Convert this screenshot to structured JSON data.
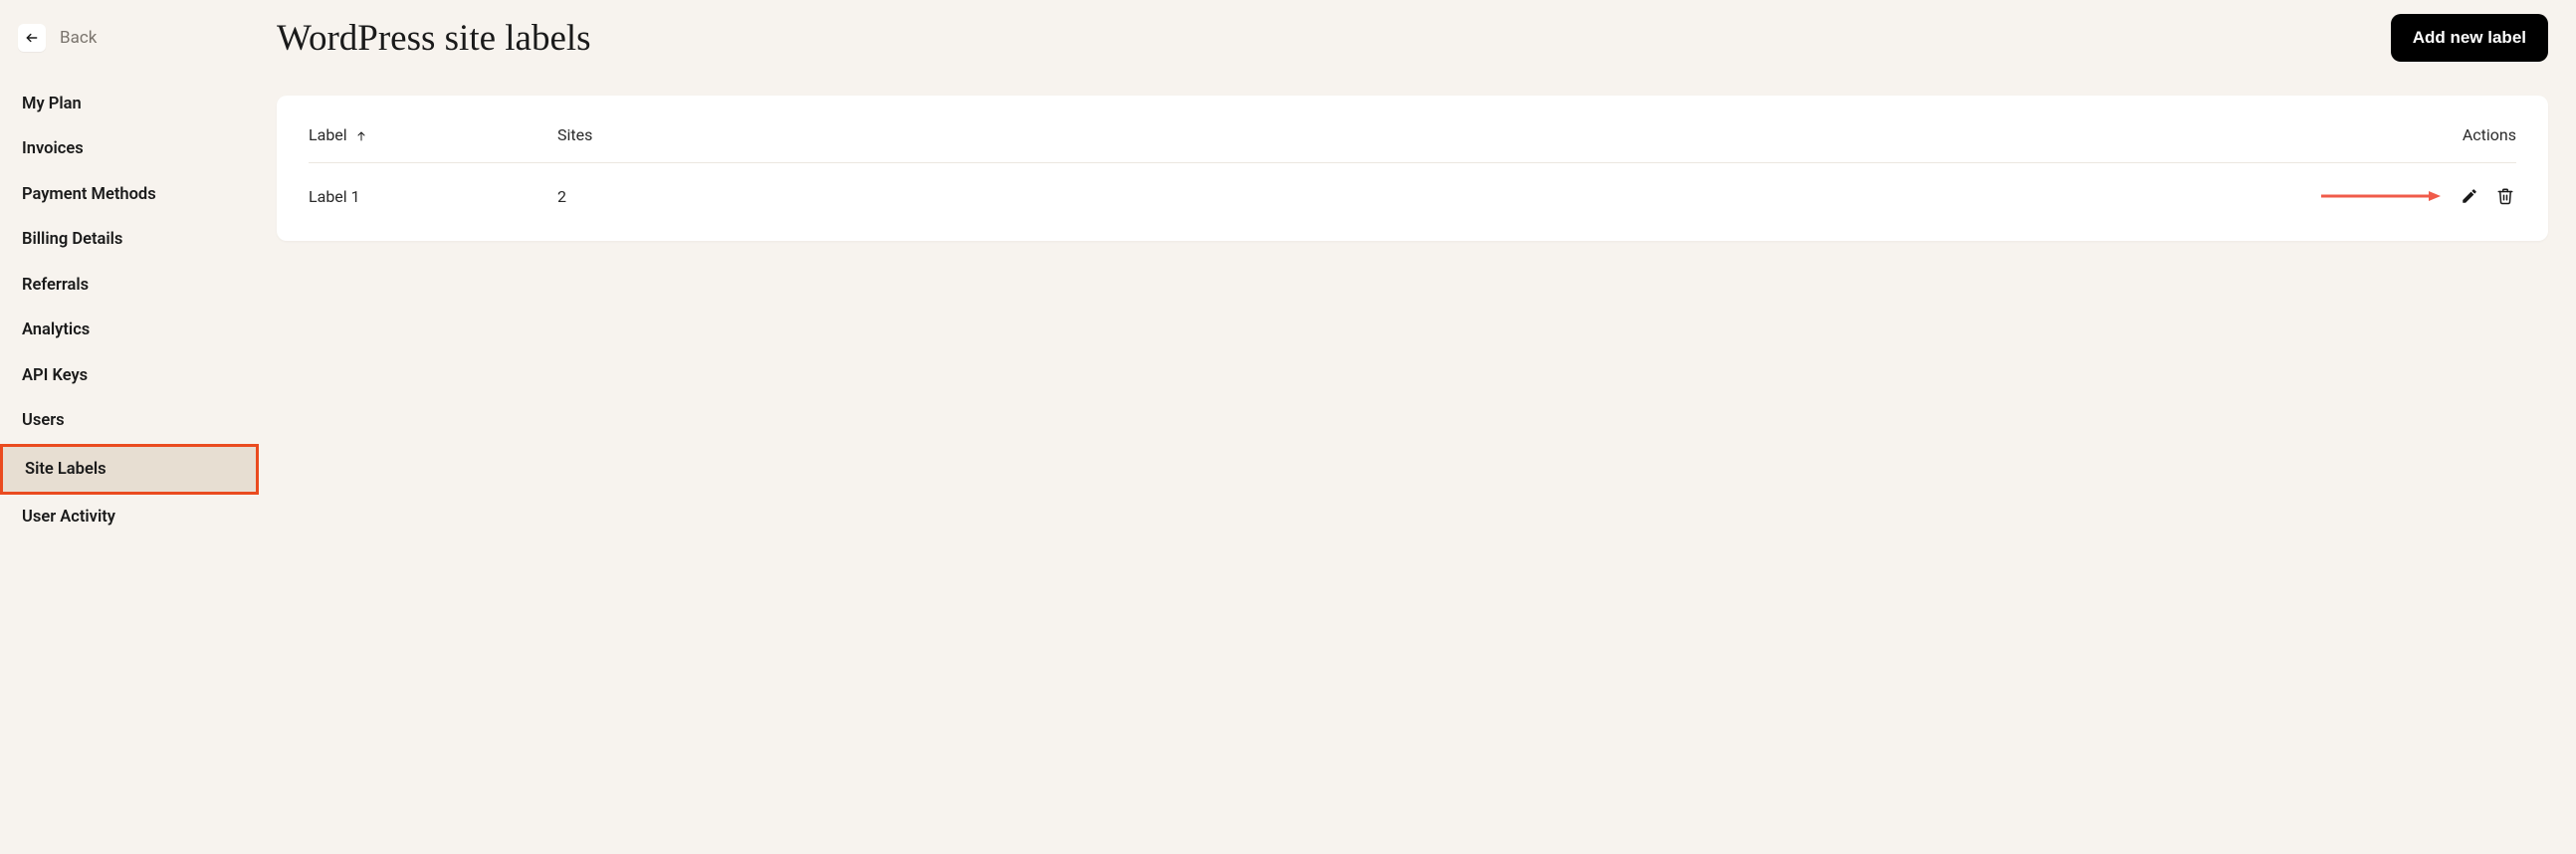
{
  "back": {
    "label": "Back"
  },
  "sidebar": {
    "items": [
      {
        "label": "My Plan",
        "active": false
      },
      {
        "label": "Invoices",
        "active": false
      },
      {
        "label": "Payment Methods",
        "active": false
      },
      {
        "label": "Billing Details",
        "active": false
      },
      {
        "label": "Referrals",
        "active": false
      },
      {
        "label": "Analytics",
        "active": false
      },
      {
        "label": "API Keys",
        "active": false
      },
      {
        "label": "Users",
        "active": false
      },
      {
        "label": "Site Labels",
        "active": true
      },
      {
        "label": "User Activity",
        "active": false
      }
    ]
  },
  "header": {
    "title": "WordPress site labels",
    "add_button": "Add new label"
  },
  "table": {
    "columns": {
      "label": "Label",
      "sites": "Sites",
      "actions": "Actions"
    },
    "rows": [
      {
        "label": "Label 1",
        "sites": "2"
      }
    ]
  },
  "annotation": {
    "arrow_color": "#f05b4a"
  }
}
